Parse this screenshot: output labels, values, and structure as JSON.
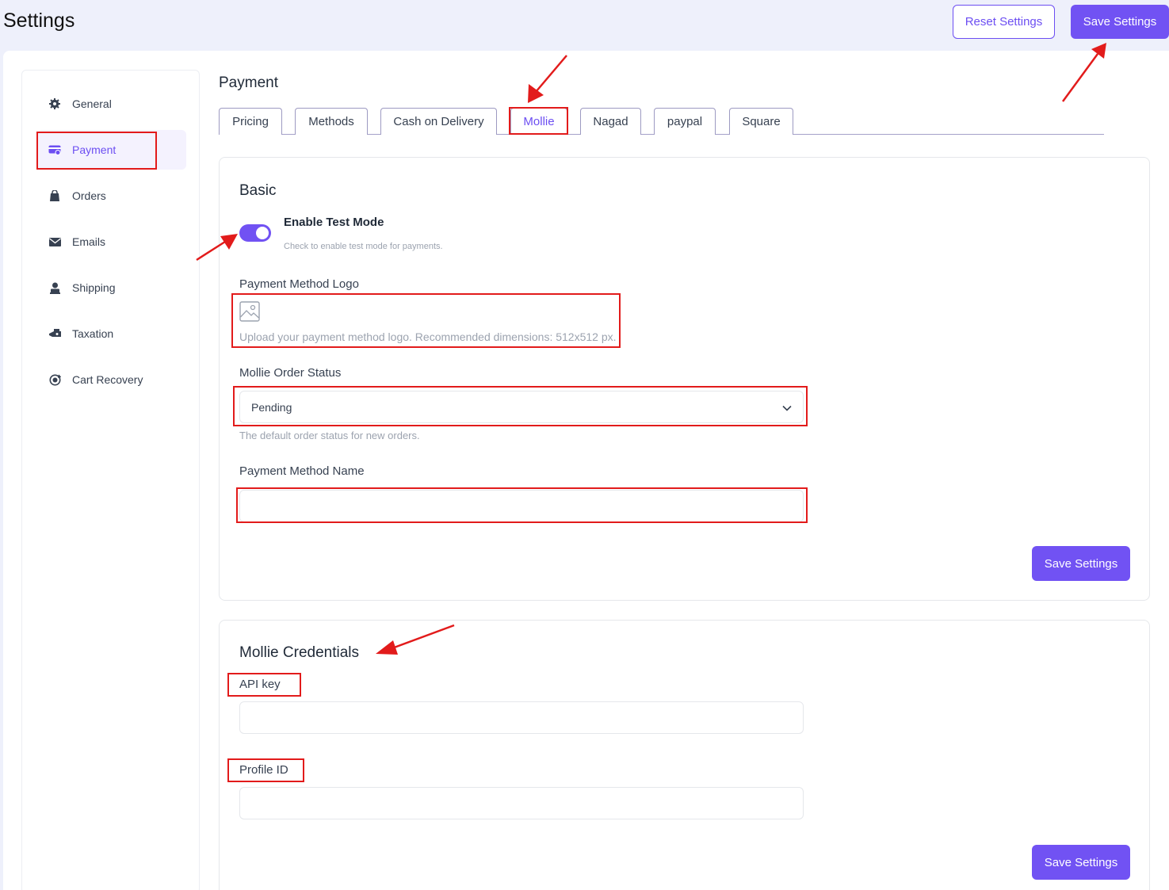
{
  "header": {
    "title": "Settings",
    "reset_label": "Reset Settings",
    "save_label": "Save Settings"
  },
  "sidebar": {
    "items": [
      {
        "label": "General",
        "icon": "gear-icon"
      },
      {
        "label": "Payment",
        "icon": "credit-card-icon"
      },
      {
        "label": "Orders",
        "icon": "shopping-bag-icon"
      },
      {
        "label": "Emails",
        "icon": "envelope-icon"
      },
      {
        "label": "Shipping",
        "icon": "shipping-icon"
      },
      {
        "label": "Taxation",
        "icon": "tax-icon"
      },
      {
        "label": "Cart Recovery",
        "icon": "cart-recovery-icon"
      }
    ],
    "active": "Payment"
  },
  "main": {
    "title": "Payment",
    "tabs": [
      "Pricing",
      "Methods",
      "Cash on Delivery",
      "Mollie",
      "Nagad",
      "paypal",
      "Square"
    ],
    "active_tab": "Mollie"
  },
  "basic": {
    "title": "Basic",
    "test_mode_label": "Enable Test Mode",
    "test_mode_help": "Check to enable test mode for payments.",
    "test_mode_enabled": true,
    "logo_label": "Payment Method Logo",
    "logo_help": "Upload your payment method logo. Recommended dimensions: 512x512 px.",
    "order_status_label": "Mollie Order Status",
    "order_status_value": "Pending",
    "order_status_help": "The default order status for new orders.",
    "method_name_label": "Payment Method Name",
    "method_name_value": "",
    "save_label": "Save Settings"
  },
  "credentials": {
    "title": "Mollie Credentials",
    "api_key_label": "API key",
    "api_key_value": "",
    "profile_id_label": "Profile ID",
    "profile_id_value": "",
    "save_label": "Save Settings"
  },
  "colors": {
    "accent": "#7152f3",
    "annotation": "#e21b1b"
  }
}
